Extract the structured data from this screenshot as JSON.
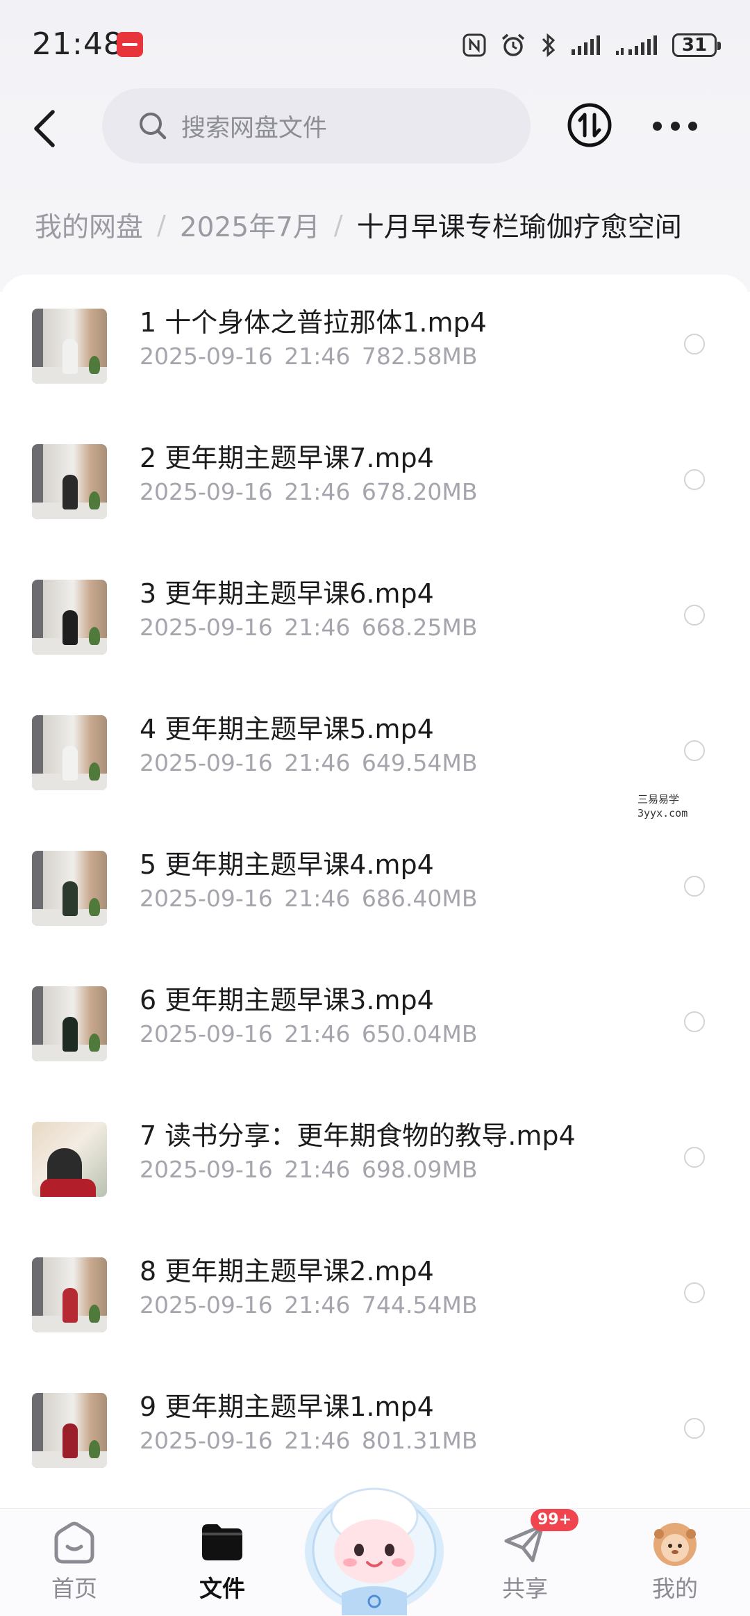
{
  "status_bar": {
    "time": "21:48",
    "battery": "31"
  },
  "header": {
    "search_placeholder": "搜索网盘文件"
  },
  "breadcrumb": {
    "root": "我的网盘",
    "level1": "2025年7月",
    "current": "十月早课专栏瑜伽疗愈空间"
  },
  "files": [
    {
      "name": "1 十个身体之普拉那体1.mp4",
      "date": "2025-09-16",
      "time": "21:46",
      "size": "782.58MB",
      "figure_color": "#f1f1ef"
    },
    {
      "name": "2 更年期主题早课7.mp4",
      "date": "2025-09-16",
      "time": "21:46",
      "size": "678.20MB",
      "figure_color": "#2a2a2a"
    },
    {
      "name": "3 更年期主题早课6.mp4",
      "date": "2025-09-16",
      "time": "21:46",
      "size": "668.25MB",
      "figure_color": "#1e1e1e"
    },
    {
      "name": "4 更年期主题早课5.mp4",
      "date": "2025-09-16",
      "time": "21:46",
      "size": "649.54MB",
      "figure_color": "#f2f2f0"
    },
    {
      "name": "5 更年期主题早课4.mp4",
      "date": "2025-09-16",
      "time": "21:46",
      "size": "686.40MB",
      "figure_color": "#2b3a2c"
    },
    {
      "name": "6 更年期主题早课3.mp4",
      "date": "2025-09-16",
      "time": "21:46",
      "size": "650.04MB",
      "figure_color": "#1d2b22"
    },
    {
      "name": "7 读书分享：更年期食物的教导.mp4",
      "date": "2025-09-16",
      "time": "21:46",
      "size": "698.09MB",
      "figure_color": "#2b2b2b"
    },
    {
      "name": "8 更年期主题早课2.mp4",
      "date": "2025-09-16",
      "time": "21:46",
      "size": "744.54MB",
      "figure_color": "#b52a33"
    },
    {
      "name": "9 更年期主题早课1.mp4",
      "date": "2025-09-16",
      "time": "21:46",
      "size": "801.31MB",
      "figure_color": "#9b1f2a"
    }
  ],
  "watermark": {
    "line1": "三易易学",
    "line2": "3yyx.com"
  },
  "bottom_nav": {
    "home": "首页",
    "files": "文件",
    "share": "共享",
    "share_badge": "99+",
    "mine": "我的"
  },
  "colors": {
    "accent": "#111111",
    "badge": "#f0444f",
    "meta_text": "#a5a5ad"
  }
}
